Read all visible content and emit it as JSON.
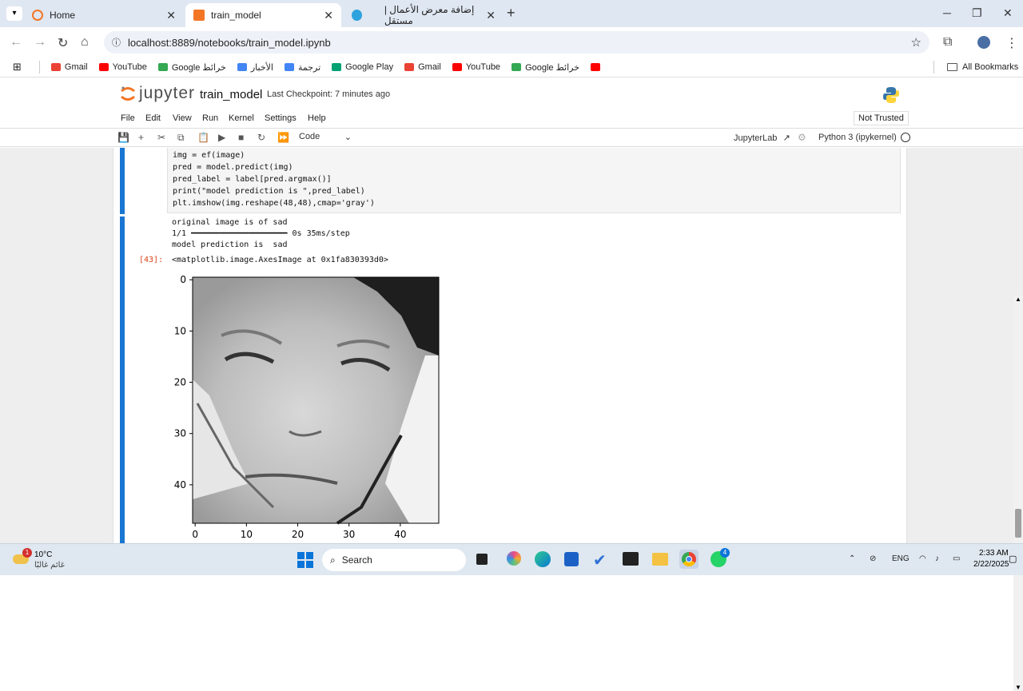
{
  "browser": {
    "tabs": [
      {
        "label": "Home",
        "active": false
      },
      {
        "label": "train_model",
        "active": true
      },
      {
        "label": "إضافة معرض الأعمال | مستقل",
        "active": false
      }
    ],
    "new_tab": "+",
    "url": "localhost:8889/notebooks/train_model.ipynb",
    "bookmarks": [
      {
        "label": "Gmail",
        "color": "#ea4335"
      },
      {
        "label": "YouTube",
        "color": "#ff0000"
      },
      {
        "label": "Google خرائط",
        "color": "#34a853"
      },
      {
        "label": "الأخبار",
        "color": "#4285f4"
      },
      {
        "label": "ترجمة",
        "color": "#4285f4"
      },
      {
        "label": "Google Play",
        "color": "#00a173"
      },
      {
        "label": "Gmail",
        "color": "#ea4335"
      },
      {
        "label": "YouTube",
        "color": "#ff0000"
      },
      {
        "label": "Google خرائط",
        "color": "#34a853"
      },
      {
        "label": "",
        "color": "#ff0000"
      }
    ],
    "all_bookmarks": "All Bookmarks"
  },
  "jupyter": {
    "logo_text": "jupyter",
    "notebook_title": "train_model",
    "checkpoint": "Last Checkpoint: 7 minutes ago",
    "not_trusted": "Not Trusted",
    "menu": [
      "File",
      "Edit",
      "View",
      "Run",
      "Kernel",
      "Settings",
      "Help"
    ],
    "cell_type": "Code",
    "jupyterlab_link": "JupyterLab",
    "kernel": "Python 3 (ipykernel)"
  },
  "cell": {
    "code_lines": [
      "img = ef(image)",
      "pred = model.predict(img)",
      "pred_label = label[pred.argmax()]",
      "print(\"model prediction is \",pred_label)",
      "plt.imshow(img.reshape(48,48),cmap='gray')"
    ],
    "output_lines": [
      "original image is of sad",
      "1/1 ━━━━━━━━━━━━━━━━━━━━ 0s 35ms/step",
      "model prediction is  sad"
    ],
    "exec_prompt": "[43]:",
    "result_repr": "<matplotlib.image.AxesImage at 0x1fa830393d0>"
  },
  "plot": {
    "y_ticks": [
      "0",
      "10",
      "20",
      "30",
      "40"
    ],
    "x_ticks": [
      "0",
      "10",
      "20",
      "30",
      "40"
    ]
  },
  "taskbar": {
    "weather_temp": "10°C",
    "weather_desc": "غائم غالبًا",
    "weather_badge": "1",
    "search": "Search",
    "lang": "ENG",
    "time": "2:33 AM",
    "date": "2/22/2025",
    "whatsapp_badge": "4"
  }
}
